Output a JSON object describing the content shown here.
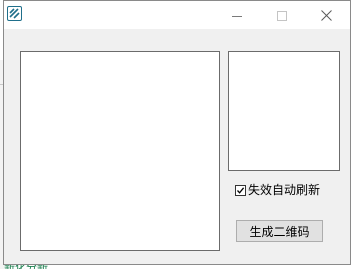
{
  "window": {
    "app_icon": "app-logo-icon",
    "controls": {
      "minimize_icon": "minimize-icon",
      "maximize_icon": "maximize-icon",
      "close_icon": "close-icon"
    }
  },
  "options": {
    "auto_refresh_label": "失效自动刷新",
    "auto_refresh_checked": true
  },
  "actions": {
    "generate_label": "生成二维码"
  },
  "background": {
    "partial_text": "新化分新"
  },
  "colors": {
    "icon_accent": "#1f6f8b",
    "background_text": "#1a7f4e"
  }
}
